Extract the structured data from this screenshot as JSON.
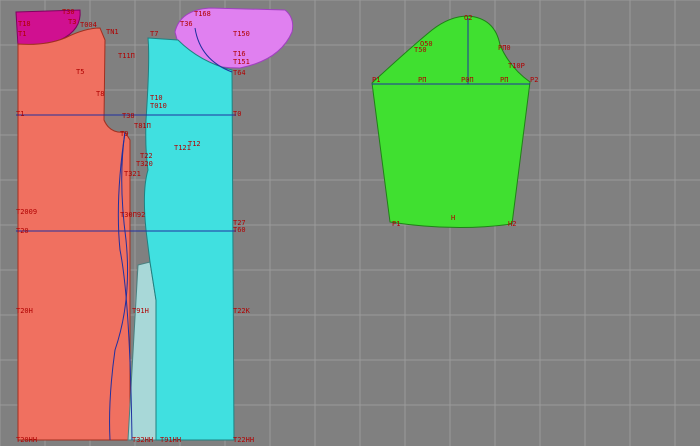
{
  "colors": {
    "background": "#808080",
    "grid": "#9a9a9a",
    "front_piece": "#f07060",
    "back_piece": "#40e0e0",
    "side_piece": "#a8d8d8",
    "collar_front": "#d01090",
    "collar_back": "#e080f0",
    "sleeve": "#40e030",
    "line": "#2030a0",
    "label": "#b00000"
  },
  "labels": {
    "t30": "T30",
    "t3": "T3",
    "t18": "T18",
    "t1": "T1",
    "t004": "T004",
    "tn1": "TN1",
    "t5": "T5",
    "t8": "T8",
    "t111": "T11П",
    "t168": "T168",
    "t150": "T150",
    "t16": "T16",
    "t151": "T151",
    "t64": "T64",
    "t7": "T7",
    "t36": "T36",
    "t10": "T10",
    "t010": "T010",
    "t1_left": "T1",
    "t0": "T0",
    "t38": "T38",
    "t81": "T81П",
    "t12": "T12",
    "t121": "T121",
    "t9": "T9",
    "t22": "T22",
    "t320": "T320",
    "t321": "T321",
    "t2009": "T2009",
    "t30n": "T30П92",
    "t27": "T27",
    "t60": "T60",
    "t20": "T20",
    "t20h": "T20Н",
    "t91h": "T91Н",
    "t22k": "T22К",
    "t20hh": "T20НН",
    "t22hh": "T22НН",
    "t32hh": "T32НН",
    "t91hh": "T91НН",
    "o2": "O2",
    "o50": "O50",
    "t50": "T50",
    "pl0": "PП0",
    "t10p": "T10Р",
    "p1": "P1",
    "p2": "P2",
    "pp_left": "PП",
    "pp_right": "PП",
    "p01": "P0П",
    "p_bottom_left": "P1",
    "p_bottom_mid": "Н",
    "p_bottom_right": "Н2"
  }
}
